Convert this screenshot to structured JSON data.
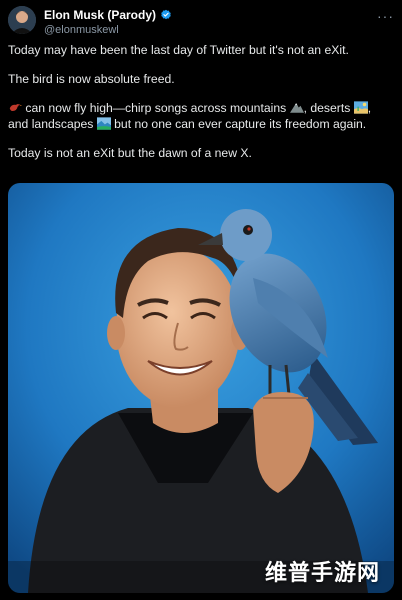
{
  "author": {
    "display_name": "Elon Musk (Parody)",
    "handle": "@elonmuskewl",
    "verified": true
  },
  "more_icon": "more-horizontal-icon",
  "post": {
    "paragraph1": "Today may have been the last day of Twitter but it's not an eXit.",
    "paragraph2": "The bird is now absolute freed.",
    "p3_a": " can now fly high—chirp songs across mountains ",
    "p3_b": ", deserts ",
    "p3_c": ", and landscapes ",
    "p3_d": " but no one can ever capture its freedom again.",
    "paragraph4": "Today is not an eXit but the dawn of a new X."
  },
  "emoji": [
    "bird-emoji",
    "mountain-emoji",
    "desert-emoji",
    "landscape-emoji"
  ],
  "media": {
    "alt": "Illustration of a smiling man holding a blue bird"
  },
  "watermark": {
    "text": "维普手游网"
  },
  "colors": {
    "accent": "#1d9bf0",
    "background": "#000000",
    "text": "#e7e9ea",
    "secondary": "#8b98a5"
  }
}
